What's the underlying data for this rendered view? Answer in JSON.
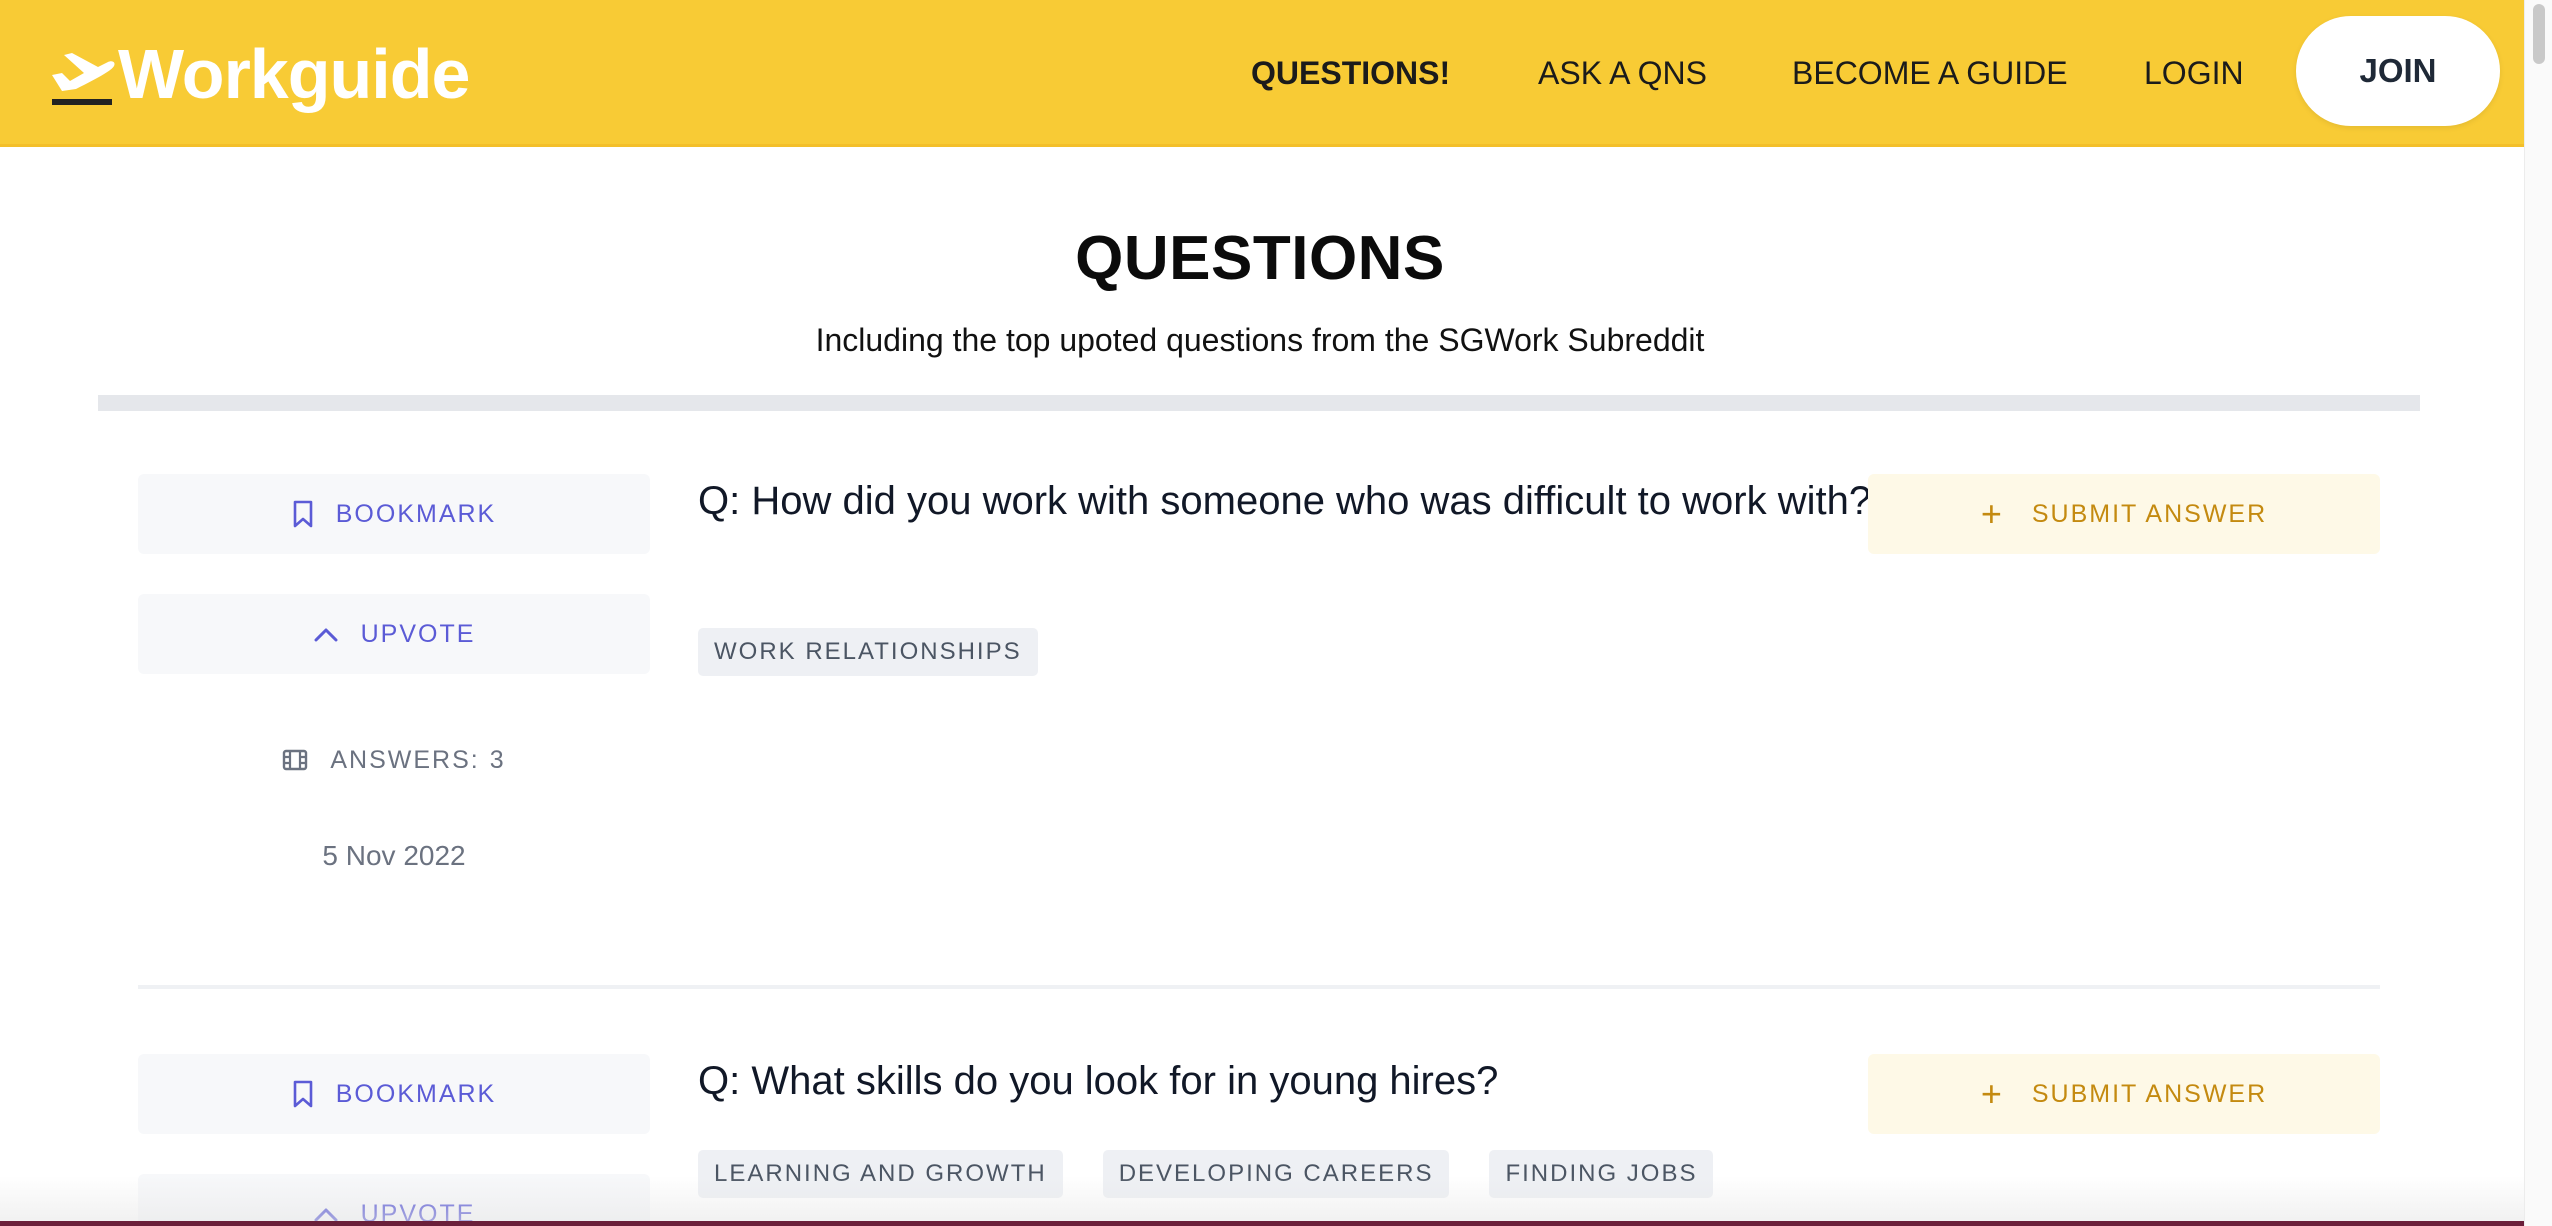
{
  "header": {
    "logo_text": "Workguide",
    "logo_icon": "plane-takeoff-icon",
    "nav": [
      {
        "label": "QUESTIONS!",
        "active": true
      },
      {
        "label": "ASK A QNS",
        "active": false
      },
      {
        "label": "BECOME A GUIDE",
        "active": false
      },
      {
        "label": "LOGIN",
        "active": false
      }
    ],
    "join_label": "JOIN"
  },
  "main": {
    "title": "QUESTIONS",
    "subtitle": "Including the top upoted questions from the SGWork Subreddit"
  },
  "questions": [
    {
      "bookmark_label": "BOOKMARK",
      "upvote_label": "UPVOTE",
      "answers_label": "ANSWERS:",
      "answers_count": "3",
      "date": "5 Nov 2022",
      "question": "Q: How did you work with someone who was difficult to work with?",
      "tags": [
        "WORK RELATIONSHIPS"
      ],
      "submit_label": "SUBMIT ANSWER"
    },
    {
      "bookmark_label": "BOOKMARK",
      "upvote_label": "UPVOTE",
      "question": "Q: What skills do you look for in young hires?",
      "tags": [
        "LEARNING AND GROWTH",
        "DEVELOPING CAREERS",
        "FINDING JOBS"
      ],
      "submit_label": "SUBMIT ANSWER"
    }
  ],
  "colors": {
    "header_bg": "#F8CB35",
    "accent_blue": "#5B5BD6",
    "accent_gold": "#C48A10"
  }
}
